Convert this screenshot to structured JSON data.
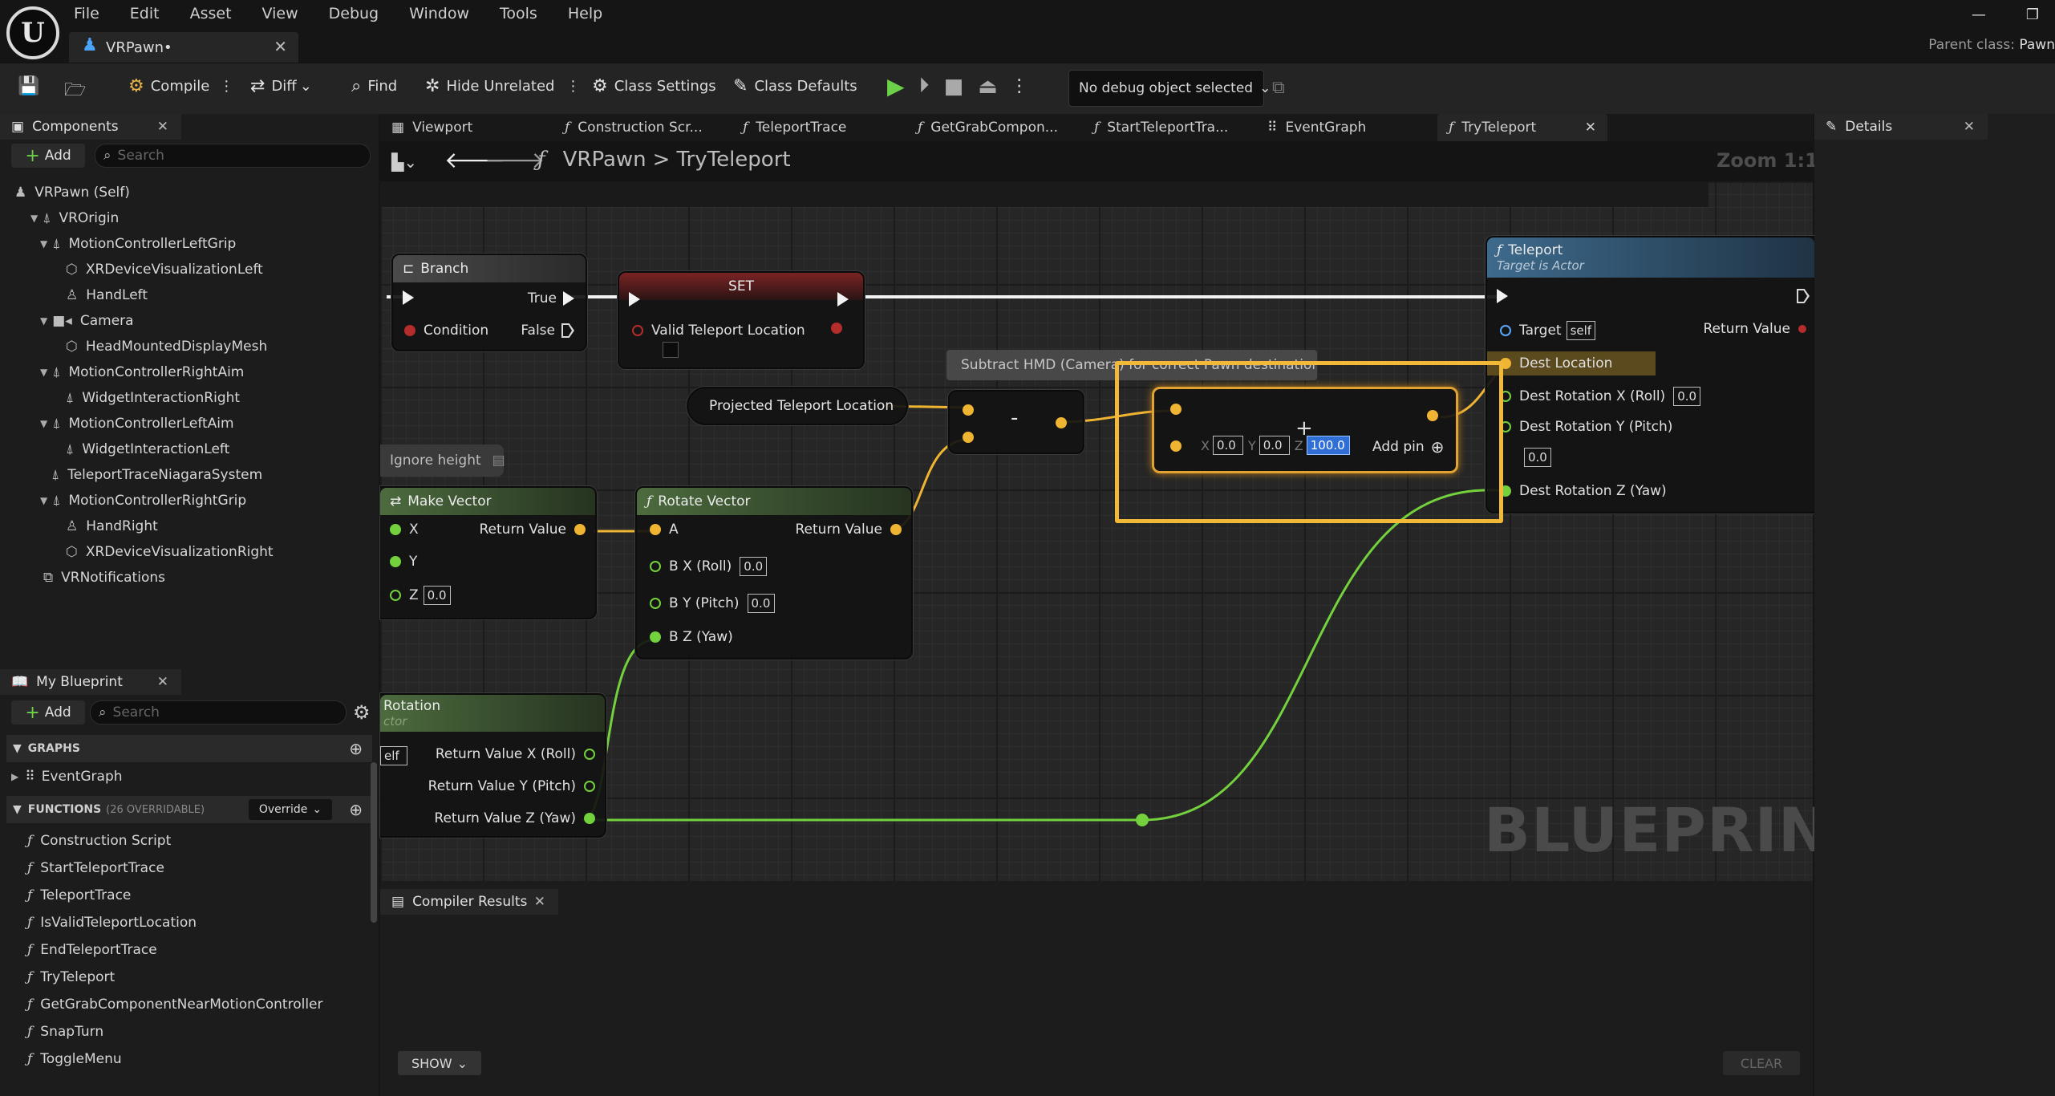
{
  "menu": [
    "File",
    "Edit",
    "Asset",
    "View",
    "Debug",
    "Window",
    "Tools",
    "Help"
  ],
  "doc_tab": "VRPawn•",
  "parent_class_label": "Parent class:",
  "parent_class_value": "Pawn",
  "toolbar": {
    "compile": "Compile",
    "diff": "Diff",
    "find": "Find",
    "hide_unrelated": "Hide Unrelated",
    "class_settings": "Class Settings",
    "class_defaults": "Class Defaults",
    "debug_select": "No debug object selected"
  },
  "components": {
    "title": "Components",
    "add": "Add",
    "search_placeholder": "Search",
    "items": [
      "VRPawn (Self)",
      "VROrigin",
      "MotionControllerLeftGrip",
      "XRDeviceVisualizationLeft",
      "HandLeft",
      "Camera",
      "HeadMountedDisplayMesh",
      "MotionControllerRightAim",
      "WidgetInteractionRight",
      "MotionControllerLeftAim",
      "WidgetInteractionLeft",
      "TeleportTraceNiagaraSystem",
      "MotionControllerRightGrip",
      "HandRight",
      "XRDeviceVisualizationRight",
      "VRNotifications"
    ]
  },
  "my_blueprint": {
    "title": "My Blueprint",
    "add": "Add",
    "search_placeholder": "Search",
    "graphs_label": "GRAPHS",
    "event_graph": "EventGraph",
    "functions_label": "FUNCTIONS",
    "functions_count": "(26 OVERRIDABLE)",
    "override": "Override",
    "functions": [
      "Construction Script",
      "StartTeleportTrace",
      "TeleportTrace",
      "IsValidTeleportLocation",
      "EndTeleportTrace",
      "TryTeleport",
      "GetGrabComponentNearMotionController",
      "SnapTurn",
      "ToggleMenu"
    ]
  },
  "tabs": [
    "Viewport",
    "Construction Scr...",
    "TeleportTrace",
    "GetGrabCompon...",
    "StartTeleportTra...",
    "EventGraph",
    "TryTeleport"
  ],
  "breadcrumb": {
    "root": "VRPawn",
    "sep": ">",
    "leaf": "TryTeleport"
  },
  "zoom": "Zoom 1:1",
  "nodes": {
    "branch": {
      "title": "Branch",
      "true": "True",
      "condition": "Condition",
      "false": "False"
    },
    "set": {
      "title": "SET",
      "pin": "Valid Teleport Location"
    },
    "teleport": {
      "title": "Teleport",
      "subtitle": "Target is Actor",
      "target": "Target",
      "target_val": "self",
      "return": "Return Value",
      "dest_location": "Dest Location",
      "rot_x": "Dest Rotation X (Roll)",
      "rot_x_val": "0.0",
      "rot_y": "Dest Rotation Y (Pitch)",
      "rot_y_val": "0.0",
      "rot_z": "Dest Rotation Z (Yaw)"
    },
    "comment": "Subtract HMD (Camera) for correct Pawn destination",
    "projected": "Projected Teleport Location",
    "subtract": "-",
    "add": {
      "x_label": "X",
      "x": "0.0",
      "y_label": "Y",
      "y": "0.0",
      "z_label": "Z",
      "z": "100.0",
      "add_pin": "Add pin"
    },
    "ignore_height": "Ignore height",
    "make_vector": {
      "title": "Make Vector",
      "x": "X",
      "y": "Y",
      "z": "Z",
      "z_val": "0.0",
      "return": "Return Value"
    },
    "rotate_vector": {
      "title": "Rotate Vector",
      "a": "A",
      "bx": "B X (Roll)",
      "bx_val": "0.0",
      "by": "B Y (Pitch)",
      "by_val": "0.0",
      "bz": "B Z (Yaw)",
      "return": "Return Value"
    },
    "rotation": {
      "title": "Rotation",
      "subtitle": "ctor",
      "self": "elf",
      "rx": "Return Value X (Roll)",
      "ry": "Return Value Y (Pitch)",
      "rz": "Return Value Z (Yaw)"
    }
  },
  "watermark": "BLUEPRINT",
  "compiler": {
    "title": "Compiler Results",
    "show": "SHOW",
    "clear": "CLEAR"
  },
  "details": {
    "title": "Details"
  },
  "colors": {
    "exec": "#f2f2f2",
    "vector": "#f0b433",
    "float": "#73d13d",
    "bool": "#b52c2c",
    "highlight": "#f2b938"
  }
}
